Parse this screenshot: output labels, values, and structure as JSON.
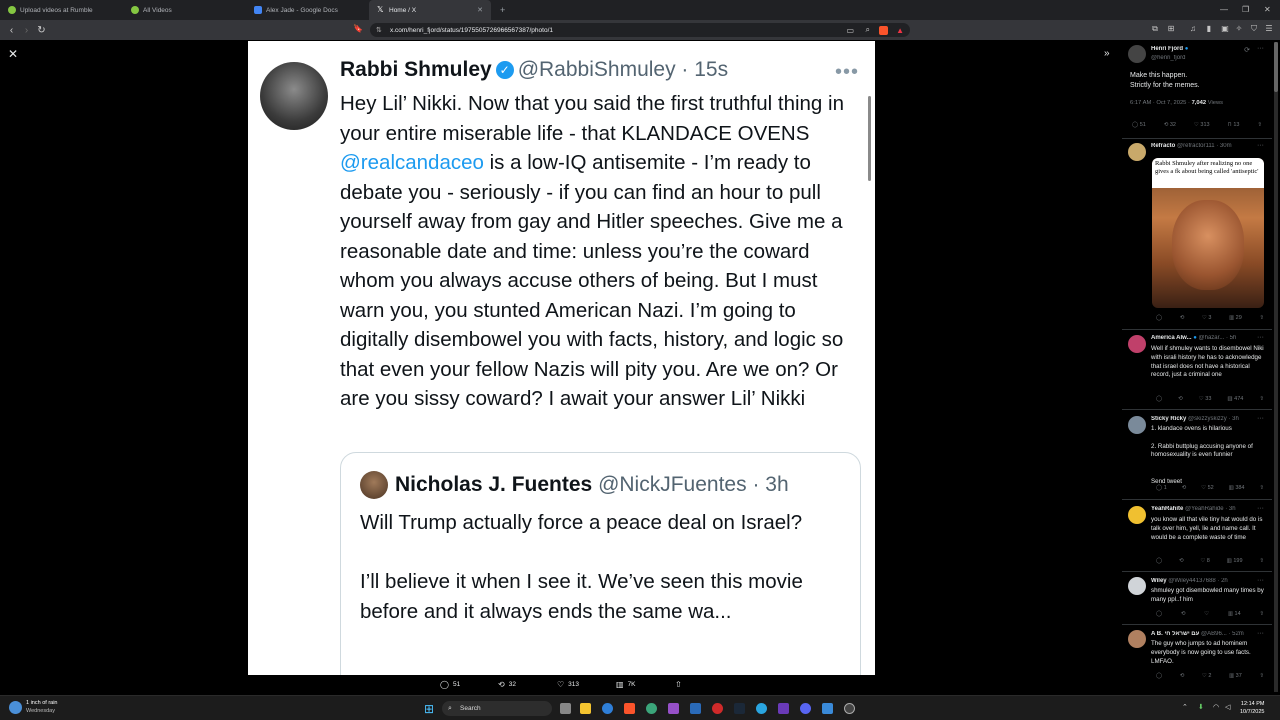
{
  "browser": {
    "tabs": [
      {
        "label": "Upload videos at Rumble",
        "color": "#85c742",
        "active": false
      },
      {
        "label": "All Videos",
        "color": "#85c742",
        "active": false
      },
      {
        "label": "Alex Jade - Google Docs",
        "color": "#4285f4",
        "active": false
      },
      {
        "label": "Home / X",
        "color": "#000000",
        "active": true
      }
    ],
    "url": "x.com/henri_fjord/status/1975505726966567387/photo/1"
  },
  "photo_tweet": {
    "name": "Rabbi Shmuley",
    "handle": "@RabbiShmuley · 15s",
    "body_pre": "Hey Lil’ Nikki. Now that you said the first truthful thing in your entire miserable life - that KLANDACE OVENS ",
    "mention": "@realcandaceo",
    "body_post": " is a low-IQ antisemite - I’m ready to debate you - seriously - if you can find an hour to pull yourself away from gay and Hitler speeches. Give me a reasonable date and time: unless you’re the coward whom you always accuse others of being. But I must warn you,  you stunted American Nazi. I’m going to digitally disembowel you with facts, history, and logic so that even your fellow Nazis will pity you. Are we on? Or are you sissy coward? I await your answer Lil’ Nikki",
    "quote": {
      "name": "Nicholas J. Fuentes",
      "handle": "@NickJFuentes · 3h",
      "body": "Will Trump actually force a peace deal on Israel?\n\nI’ll believe it when I see it. We’ve seen this movie before and it always ends the same wa..."
    }
  },
  "photo_actions": {
    "replies": "51",
    "reposts": "32",
    "likes": "313",
    "views": "7K"
  },
  "sidebar": {
    "main": {
      "name": "Henri Fjord",
      "handle": "@henri_fjord",
      "text": "Make this happen.\nStrictly for the memes.",
      "time": "6:17 AM · Oct 7, 2025 ·",
      "views_count": "7,042",
      "views_label": "Views",
      "replies": "51",
      "reposts": "32",
      "likes": "313",
      "bookmarks": "13"
    },
    "replies": [
      {
        "name": "Refracto",
        "handle": "@refractor111 · 30m",
        "text": "",
        "meme_caption": "Rabbi Shmuley after realizing no one gives a fk about being called 'antiseptic'",
        "c": "",
        "r": "",
        "l": "3",
        "v": "29",
        "avatar": "#c9a96a"
      },
      {
        "name": "America Alw...",
        "handle": "@hazar... · 5h",
        "text": "Well if shmuley wants to disembowel Niki with israli history he has to acknowledge that israel does not have a historical record, just a criminal one",
        "c": "",
        "r": "",
        "l": "33",
        "v": "474",
        "avatar": "#c0406a"
      },
      {
        "name": "Sticky Ricky",
        "handle": "@skizzyskizzy · 3h",
        "text": "1. klandace ovens is hilarious\n\n2. Rabbi buttplug accusing anyone of homosexuality is even funnier\n\n\nSend tweet",
        "c": "1",
        "r": "",
        "l": "52",
        "v": "384",
        "avatar": "#7a8a9a"
      },
      {
        "name": "YeahRahite",
        "handle": "@YeahRahide · 3h",
        "text": "you know all that vile tiny hat would do is talk over him, yell, lie and name call. It would be a complete waste of time",
        "c": "",
        "r": "",
        "l": "8",
        "v": "199",
        "avatar": "#f0c030"
      },
      {
        "name": "Wiley",
        "handle": "@Wiley44137688 · 2h",
        "text": "shmuley got disembowled many times by many ppl..f him",
        "c": "",
        "r": "",
        "l": "",
        "v": "14",
        "avatar": "#d0d4d8"
      },
      {
        "name": "A B. עם ישראל חי",
        "handle": "@AB96... · 52m",
        "text": "The guy who jumps to ad hominem everybody is now going to use facts. LMFAO.",
        "c": "",
        "r": "",
        "l": "2",
        "v": "37",
        "avatar": "#b08060"
      }
    ]
  },
  "taskbar": {
    "weather_title": "1 inch of rain",
    "weather_sub": "Wednesday",
    "search": "Search",
    "time": "12:14 PM",
    "date": "10/7/2025"
  }
}
